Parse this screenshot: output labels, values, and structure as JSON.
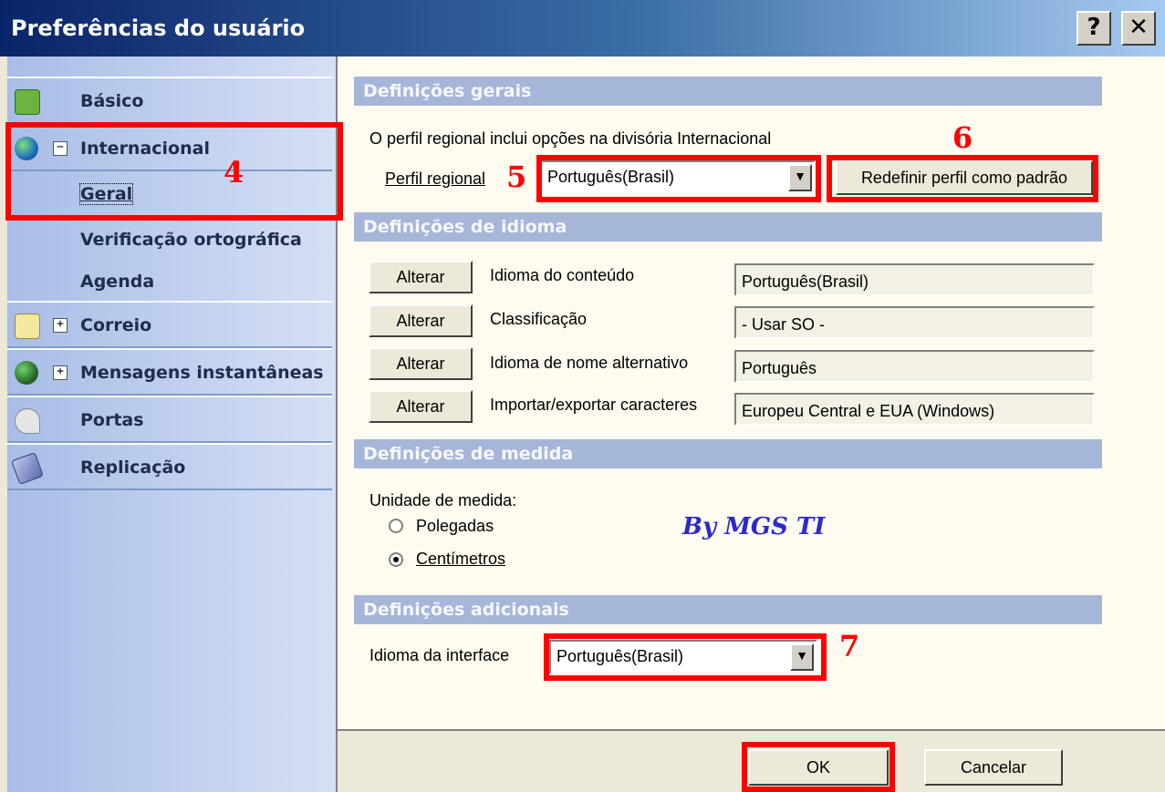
{
  "window": {
    "title": "Preferências do usuário",
    "help_label": "?",
    "close_label": "✕"
  },
  "sidebar": {
    "items": [
      {
        "label": "Básico",
        "icon": "basic-icon",
        "expander": ""
      },
      {
        "label": "Internacional",
        "icon": "globe-icon",
        "expander": "−"
      },
      {
        "label": "Correio",
        "icon": "mail-icon",
        "expander": "+"
      },
      {
        "label": "Mensagens instantâneas",
        "icon": "instant-messages-icon",
        "expander": "+"
      },
      {
        "label": "Portas",
        "icon": "ports-icon",
        "expander": ""
      },
      {
        "label": "Replicação",
        "icon": "replication-icon",
        "expander": ""
      }
    ],
    "subitems": [
      "Geral",
      "Verificação ortográfica",
      "Agenda"
    ]
  },
  "sections": {
    "general": {
      "header": "Definições gerais",
      "description": "O perfil regional inclui opções na divisória Internacional",
      "profile_label": "Perfil regional",
      "profile_value": "Português(Brasil)",
      "reset_button": "Redefinir perfil como padrão"
    },
    "language": {
      "header": "Definições de idioma",
      "rows": [
        {
          "button": "Alterar",
          "label": "Idioma do conteúdo",
          "value": "Português(Brasil)"
        },
        {
          "button": "Alterar",
          "label": "Classificação",
          "value": "- Usar SO -"
        },
        {
          "button": "Alterar",
          "label": "Idioma de nome alternativo",
          "value": "Português"
        },
        {
          "button": "Alterar",
          "label": "Importar/exportar caracteres",
          "value": "Europeu Central e EUA (Windows)"
        }
      ]
    },
    "measure": {
      "header": "Definições de medida",
      "unit_label": "Unidade de medida:",
      "options": [
        "Polegadas",
        "Centímetros"
      ],
      "selected": "Centímetros"
    },
    "additional": {
      "header": "Definições adicionais",
      "interface_label": "Idioma da interface",
      "interface_value": "Português(Brasil)"
    }
  },
  "watermark": "By MGS TI",
  "annotations": [
    "4",
    "5",
    "6",
    "7"
  ],
  "footer": {
    "ok": "OK",
    "cancel": "Cancelar"
  },
  "colors": {
    "annotation": "#ff0000",
    "section_header": "#a6b6d9",
    "title_bar": "#0a246a"
  }
}
